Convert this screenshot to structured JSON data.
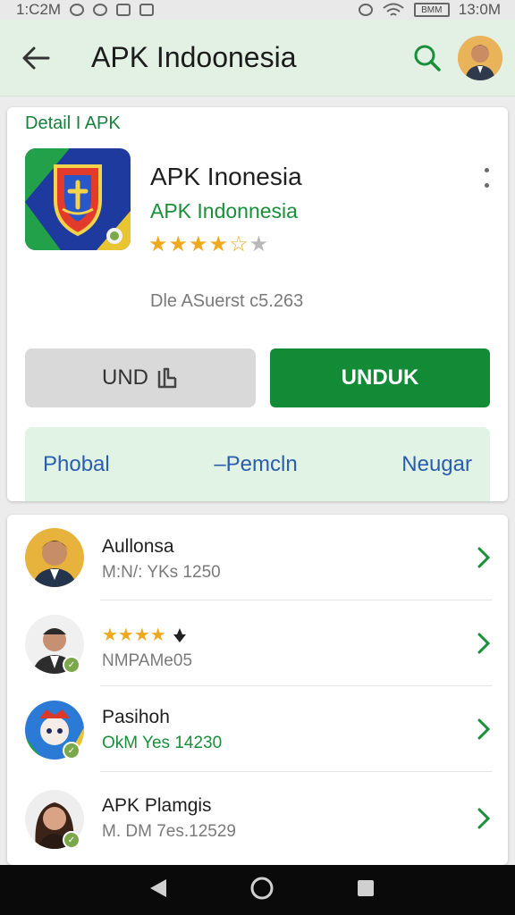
{
  "status_bar": {
    "time_left": "1:C2M",
    "time_right": "13:0M",
    "battery": "BMM"
  },
  "app_bar": {
    "title": "APK Indoonesia"
  },
  "detail": {
    "breadcrumb": "Detail I APK",
    "name": "APK Inonesia",
    "developer": "APK Indonnesia",
    "rating": 3.5,
    "meta": "Dle ASuerst c5.263",
    "secondary_button": "UND",
    "primary_button": "UNDUK",
    "tabs": [
      "Phobal",
      "–Pemcln",
      "Neugar"
    ]
  },
  "list": [
    {
      "title": "Aullonsa",
      "subtitle": "M:N/: YKs 1250",
      "badge": false
    },
    {
      "stars": "★★★★",
      "subtitle": "NMPAMe05",
      "badge": true
    },
    {
      "title": "Pasihoh",
      "subtitle": "OkM Yes 14230",
      "badge": true
    },
    {
      "title": "APK Plamgis",
      "subtitle": "M. DM 7es.12529",
      "badge": true
    }
  ],
  "colors": {
    "accent_green": "#138a36",
    "tab_blue": "#2a5db0",
    "star": "#f0a81e",
    "app_bar_bg": "#e3f1e5"
  }
}
